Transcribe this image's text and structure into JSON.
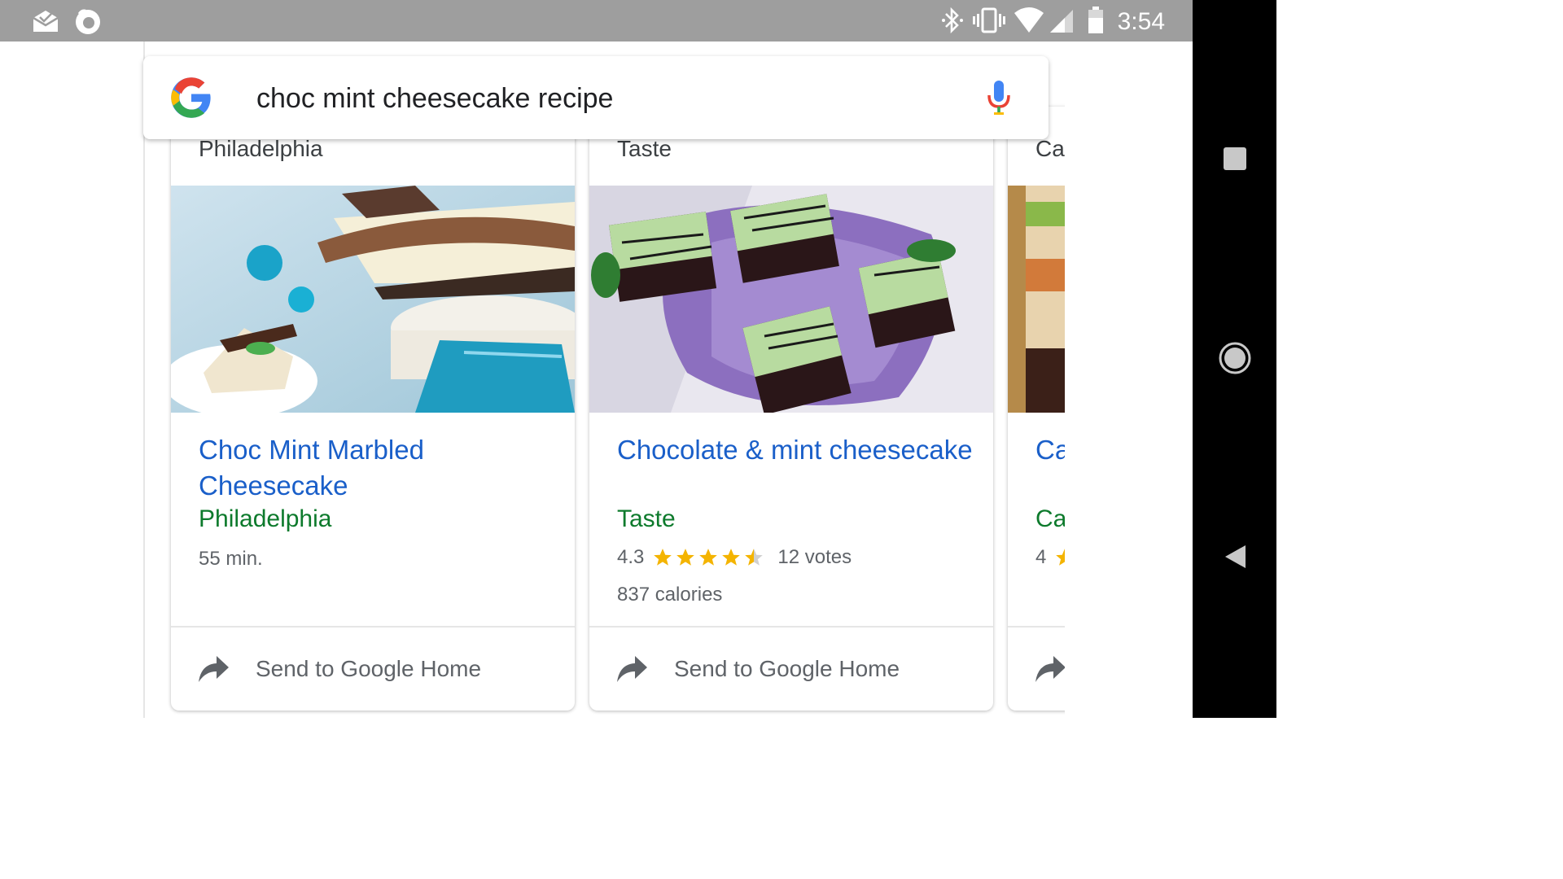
{
  "status_bar": {
    "time": "3:54",
    "left_icons": [
      "mail-notification-icon",
      "firefox-icon"
    ],
    "right_icons": [
      "bluetooth-icon",
      "vibrate-icon",
      "wifi-icon",
      "cell-signal-icon",
      "battery-icon"
    ]
  },
  "search": {
    "query": "choc mint cheesecake recipe",
    "logo_icon": "google-g-icon",
    "mic_icon": "microphone-icon"
  },
  "cards": [
    {
      "source_top": "Philadelphia",
      "title": "Choc Mint Marbled Cheesecake",
      "source": "Philadelphia",
      "time": "55 min.",
      "action_label": "Send to Google Home"
    },
    {
      "source_top": "Taste",
      "title": "Chocolate & mint cheesecake",
      "source": "Taste",
      "rating": "4.3",
      "rating_value": 4.3,
      "votes": "12 votes",
      "calories": "837 calories",
      "action_label": "Send to Google Home"
    },
    {
      "source_top": "Ca",
      "title": "Ca Pe",
      "source": "Ca",
      "rating": "4"
    }
  ],
  "nav_bar": {
    "buttons": [
      "recents-icon",
      "home-icon",
      "back-icon"
    ]
  },
  "colors": {
    "status_bar": "#9e9e9e",
    "title_link": "#1a5fc9",
    "source_green": "#0d7a2c",
    "star": "#f4b400"
  }
}
